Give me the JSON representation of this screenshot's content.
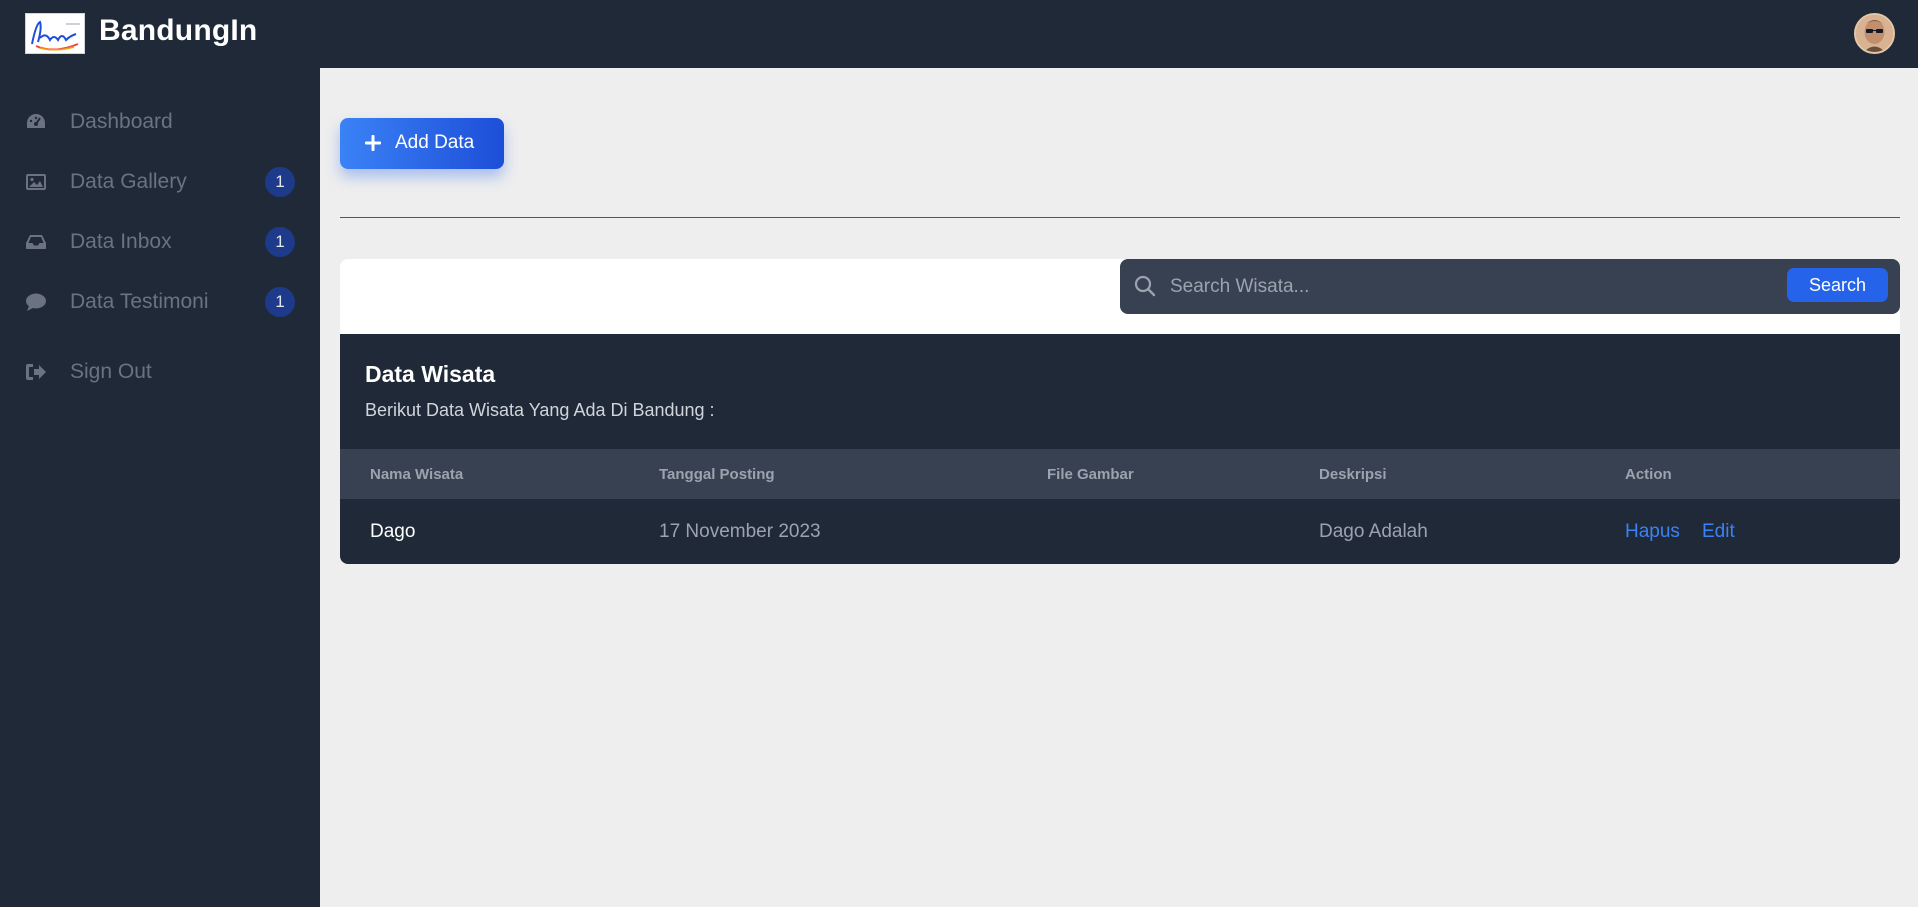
{
  "app": {
    "brand": "BandungIn"
  },
  "sidebar": {
    "items": [
      {
        "label": "Dashboard",
        "icon": "dashboard-icon",
        "badge": ""
      },
      {
        "label": "Data Gallery",
        "icon": "image-icon",
        "badge": "1"
      },
      {
        "label": "Data Inbox",
        "icon": "inbox-icon",
        "badge": "1"
      },
      {
        "label": "Data Testimoni",
        "icon": "comment-icon",
        "badge": "1"
      },
      {
        "label": "Sign Out",
        "icon": "sign-out-icon",
        "badge": ""
      }
    ]
  },
  "toolbar": {
    "add_label": "Add Data"
  },
  "search": {
    "placeholder": "Search Wisata...",
    "value": "",
    "button_label": "Search"
  },
  "table": {
    "title": "Data Wisata",
    "subtitle": "Berikut Data Wisata Yang Ada Di Bandung :",
    "columns": [
      "Nama Wisata",
      "Tanggal Posting",
      "File Gambar",
      "Deskripsi",
      "Action"
    ],
    "rows": [
      {
        "nama": "Dago",
        "tanggal": "17 November 2023",
        "file": "",
        "deskripsi": "Dago Adalah",
        "actions": [
          "Hapus",
          "Edit"
        ]
      }
    ]
  },
  "colors": {
    "sidebar_bg": "#1f2937",
    "accent": "#2563eb",
    "link": "#3b82f6",
    "badge_bg": "#1e3a8a",
    "content_bg": "#eeeeee"
  }
}
